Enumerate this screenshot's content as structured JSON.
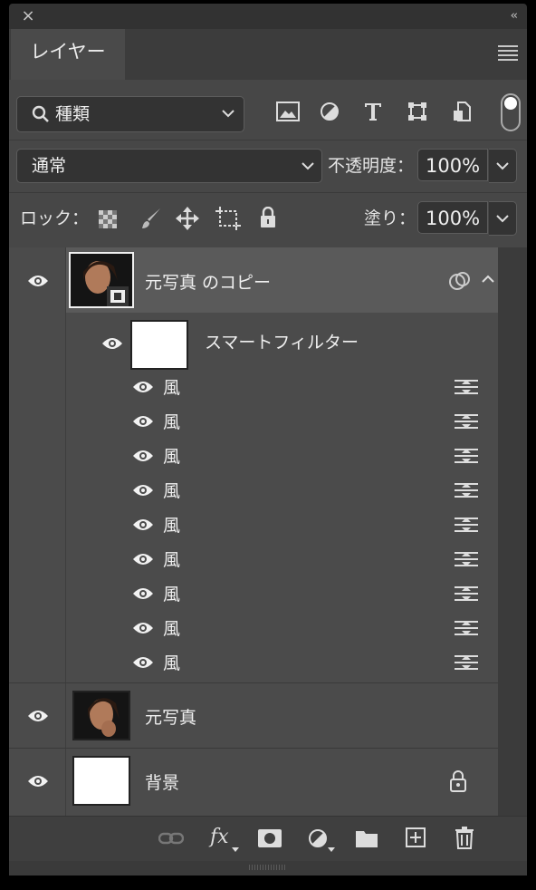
{
  "panel": {
    "close_glyph": "×",
    "collapse_glyph": "‹‹",
    "tab_label": "レイヤー",
    "menu_icon": "panel-menu-icon"
  },
  "filter": {
    "kind_label": "種類",
    "icons": [
      "image-filter-icon",
      "adjustment-filter-icon",
      "type-filter-icon",
      "shape-filter-icon",
      "smart-object-filter-icon"
    ]
  },
  "blend": {
    "mode": "通常",
    "opacity_label": "不透明度：",
    "opacity_value": "100%"
  },
  "lock": {
    "label": "ロック：",
    "icons": [
      "lock-transparent-pixels-icon",
      "lock-image-pixels-icon",
      "lock-position-icon",
      "lock-artboard-icon",
      "lock-all-icon"
    ],
    "fill_label": "塗り：",
    "fill_value": "100%"
  },
  "layers": [
    {
      "name": "元写真 のコピー",
      "type": "smart-object",
      "selected": true
    },
    {
      "smart_filters_label": "スマートフィルター"
    },
    {
      "filters": [
        "風",
        "風",
        "風",
        "風",
        "風",
        "風",
        "風",
        "風",
        "風"
      ]
    },
    {
      "name": "元写真",
      "type": "photo"
    },
    {
      "name": "背景",
      "type": "background",
      "locked": true
    }
  ],
  "bottom": {
    "fx_label": "fx",
    "icons": [
      "link-layers-icon",
      "fx-icon",
      "layer-mask-icon",
      "adjustment-layer-icon",
      "group-folder-icon",
      "new-layer-icon",
      "trash-icon"
    ]
  },
  "colors": {
    "panel_bg": "#474747",
    "selected_row": "#5a5a5a",
    "dark_field": "#333333"
  }
}
